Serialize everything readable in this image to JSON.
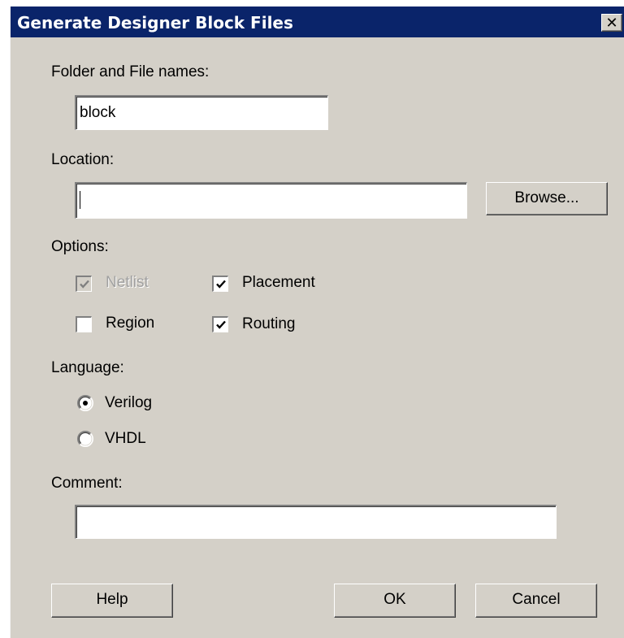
{
  "window": {
    "title": "Generate Designer Block Files",
    "close_glyph": "✕"
  },
  "folder": {
    "label": "Folder and File names:",
    "value": "block"
  },
  "location": {
    "label": "Location:",
    "value": "",
    "browse_label": "Browse..."
  },
  "options": {
    "label": "Options:",
    "netlist": {
      "label": "Netlist",
      "checked": true,
      "enabled": false
    },
    "placement": {
      "label": "Placement",
      "checked": true,
      "enabled": true
    },
    "region": {
      "label": "Region",
      "checked": false,
      "enabled": true
    },
    "routing": {
      "label": "Routing",
      "checked": true,
      "enabled": true
    }
  },
  "language": {
    "label": "Language:",
    "verilog": {
      "label": "Verilog",
      "selected": true
    },
    "vhdl": {
      "label": "VHDL",
      "selected": false
    }
  },
  "comment": {
    "label": "Comment:",
    "value": ""
  },
  "buttons": {
    "help": "Help",
    "ok": "OK",
    "cancel": "Cancel"
  },
  "colors": {
    "titlebar": "#0a246a",
    "dialog_face": "#d4d0c8",
    "disabled_text": "#a0a0a0"
  }
}
